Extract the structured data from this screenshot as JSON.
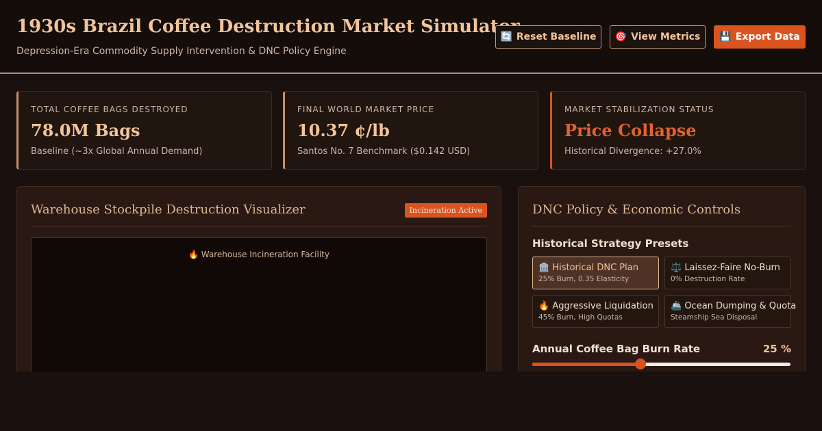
{
  "header": {
    "title": "1930s Brazil Coffee Destruction Market Simulator",
    "subtitle": "Depression-Era Commodity Supply Intervention & DNC Policy Engine",
    "buttons": {
      "reset": {
        "icon": "🔄",
        "label": "Reset Baseline"
      },
      "metrics": {
        "icon": "🎯",
        "label": "View Metrics"
      },
      "export": {
        "icon": "💾",
        "label": "Export Data"
      }
    }
  },
  "stats": [
    {
      "label": "TOTAL COFFEE BAGS DESTROYED",
      "value": "78.0M Bags",
      "sub": "Baseline (~3x Global Annual Demand)"
    },
    {
      "label": "FINAL WORLD MARKET PRICE",
      "value": "10.37 ¢/lb",
      "sub": "Santos No. 7 Benchmark ($0.142 USD)"
    },
    {
      "label": "MARKET STABILIZATION STATUS",
      "value": "Price Collapse",
      "sub": "Historical Divergence: +27.0%"
    }
  ],
  "visualizer": {
    "title": "Warehouse Stockpile Destruction Visualizer",
    "badge": "Incineration Active",
    "facility_label": "🔥 Warehouse Incineration Facility"
  },
  "controls": {
    "title": "DNC Policy & Economic Controls",
    "presets_heading": "Historical Strategy Presets",
    "presets": [
      {
        "name": "🏛️ Historical DNC Plan",
        "desc": "25% Burn, 0.35 Elasticity"
      },
      {
        "name": "⚖️ Laissez-Faire No-Burn",
        "desc": "0% Destruction Rate"
      },
      {
        "name": "🔥 Aggressive Liquidation",
        "desc": "45% Burn, High Quotas"
      },
      {
        "name": "🚢 Ocean Dumping & Quota",
        "desc": "Steamship Sea Disposal"
      }
    ],
    "burn_rate": {
      "label": "Annual Coffee Bag Burn Rate",
      "display": "25 %",
      "fraction": 0.42
    }
  },
  "colors": {
    "accent": "#d9541f",
    "gold": "#f2c49a",
    "background": "#1a100d"
  }
}
